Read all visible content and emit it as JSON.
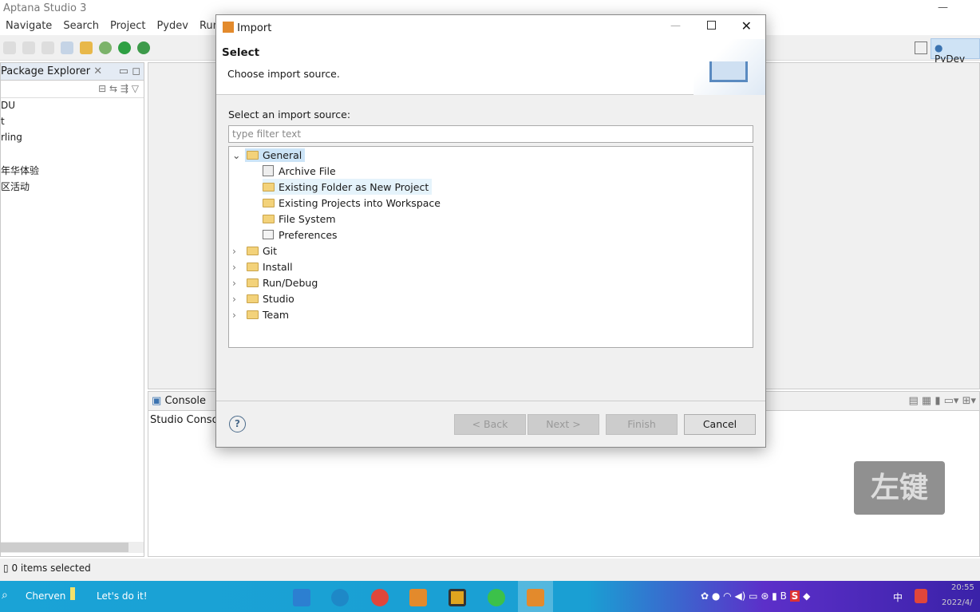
{
  "app": {
    "title": "Aptana Studio 3"
  },
  "menu": [
    "Navigate",
    "Search",
    "Project",
    "Pydev",
    "Run"
  ],
  "perspective": {
    "label": "PyDev"
  },
  "package_explorer": {
    "tab": "Package Explorer",
    "items": [
      "DU",
      "t",
      "rling",
      "",
      "年华体验",
      "区活动"
    ]
  },
  "console": {
    "tab": "Console",
    "title": "Studio Consol"
  },
  "status": {
    "text": "0 items selected"
  },
  "dialog": {
    "title": "Import",
    "heading": "Select",
    "subheading": "Choose import source.",
    "source_label": "Select an import source:",
    "filter_placeholder": "type filter text",
    "tree": [
      {
        "label": "General",
        "expanded": true,
        "selected": true,
        "children": [
          {
            "label": "Archive File",
            "icon": "archive-icon"
          },
          {
            "label": "Existing Folder as New Project",
            "icon": "folder-open-icon",
            "hovered": true
          },
          {
            "label": "Existing Projects into Workspace",
            "icon": "folder-open-icon"
          },
          {
            "label": "File System",
            "icon": "folder-icon"
          },
          {
            "label": "Preferences",
            "icon": "preferences-icon"
          }
        ]
      },
      {
        "label": "Git"
      },
      {
        "label": "Install"
      },
      {
        "label": "Run/Debug"
      },
      {
        "label": "Studio"
      },
      {
        "label": "Team"
      }
    ],
    "buttons": {
      "back": "< Back",
      "next": "Next >",
      "finish": "Finish",
      "cancel": "Cancel"
    }
  },
  "overlay": {
    "text": "左键"
  },
  "taskbar": {
    "user": "Cherven",
    "motto": "Let's do it!",
    "time": "20:55",
    "date": "2022/4/",
    "ime": "中"
  }
}
